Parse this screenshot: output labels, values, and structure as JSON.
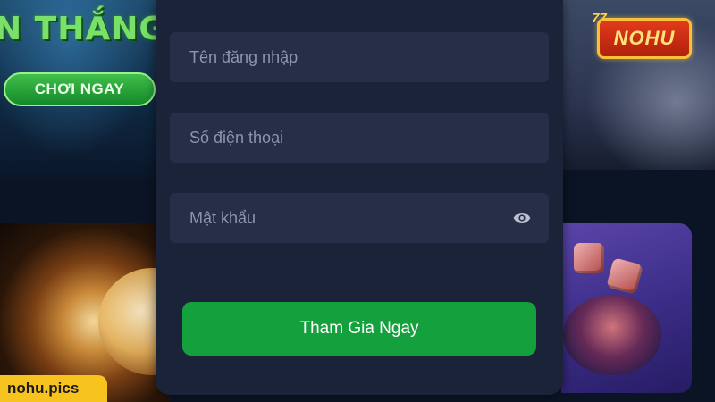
{
  "banner": {
    "headline": "N THẮNG",
    "play_button": "CHƠI NGAY"
  },
  "logo": {
    "brand": "NOHU",
    "badge": "77"
  },
  "form": {
    "username_placeholder": "Tên đăng nhập",
    "phone_placeholder": "Số điện thoại",
    "password_placeholder": "Mật khẩu",
    "password_toggle_icon": "eye-icon",
    "submit_label": "Tham Gia Ngay"
  },
  "watermark": {
    "text": "nohu.pics"
  },
  "colors": {
    "panel_bg": "#1a2338",
    "field_bg": "#262f47",
    "submit_bg": "#14a03c",
    "play_button_bg": "#1f9a32",
    "watermark_bg": "#f7c31f"
  }
}
